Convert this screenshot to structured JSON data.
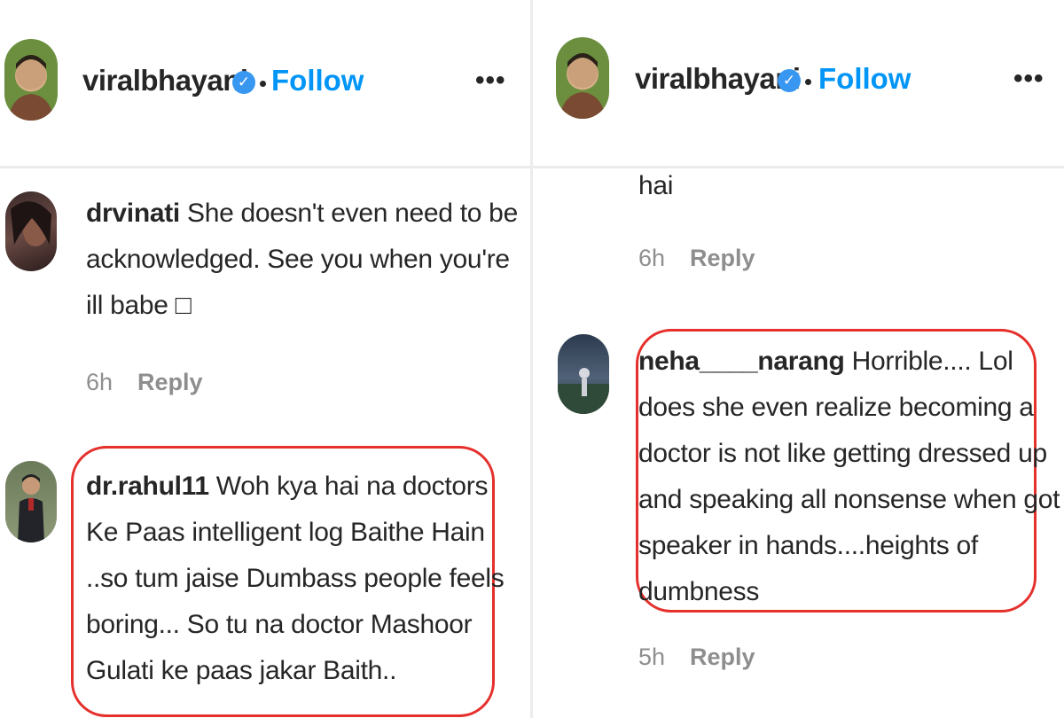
{
  "left": {
    "header": {
      "username": "viralbhayani",
      "follow_label": "Follow",
      "more_label": "•••"
    },
    "comments": [
      {
        "username": "drvinati",
        "lines": [
          "She doesn't even need to be",
          "acknowledged. See you when you're",
          "ill babe □"
        ],
        "time": "6h",
        "reply_label": "Reply"
      },
      {
        "username": "dr.rahul11",
        "lines": [
          "Woh kya hai na doctors",
          "Ke Paas intelligent log Baithe Hain",
          "..so tum jaise Dumbass people feels",
          "boring... So tu na doctor Mashoor",
          "Gulati ke paas jakar Baith.."
        ]
      }
    ]
  },
  "right": {
    "header": {
      "username": "viralbhayani",
      "follow_label": "Follow",
      "more_label": "•••"
    },
    "comments": [
      {
        "tail": "hai",
        "time": "6h",
        "reply_label": "Reply"
      },
      {
        "username": "neha____narang",
        "lines": [
          "Horrible.... Lol",
          "does she even realize becoming a",
          "doctor is not like getting dressed up",
          "and speaking all nonsense when got",
          "speaker in hands....heights of",
          "dumbness"
        ],
        "time": "5h",
        "reply_label": "Reply"
      }
    ]
  },
  "colors": {
    "follow": "#0095f6",
    "verified": "#3897f0",
    "highlight": "#e5302c",
    "meta": "#8e8e8e"
  }
}
